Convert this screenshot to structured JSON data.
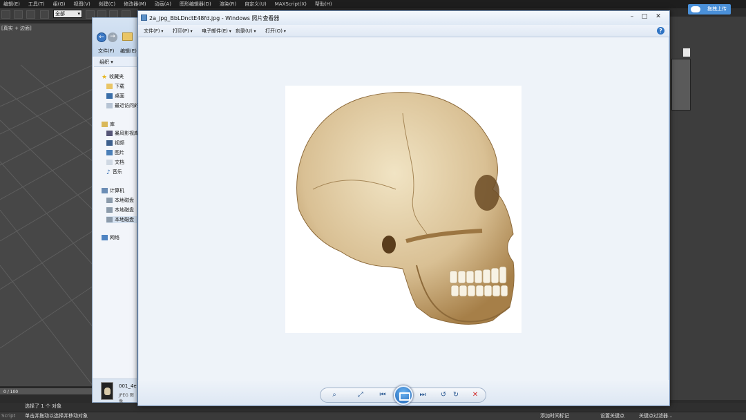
{
  "max": {
    "menu": [
      "编辑(E)",
      "工具(T)",
      "组(G)",
      "视图(V)",
      "创建(C)",
      "修改器(M)",
      "动画(A)",
      "图形编辑器(D)",
      "渲染(R)",
      "自定义(U)",
      "MAXScript(X)",
      "帮助(H)"
    ],
    "selection_filter": "全部",
    "viewport_label": "[真实 + 边面]",
    "time_slider": "0 / 100",
    "status_selected": "选择了 1 个 对象",
    "status_hint": "单击并拖动以选择并移动对象",
    "status_left": "Script",
    "set_key": "设置关键点",
    "key_filters": "关键点过滤器...",
    "add_time_tag": "添加时间标记",
    "upload_button": "拖拽上传"
  },
  "explorer": {
    "menu": [
      "文件(F)",
      "编辑(E)"
    ],
    "organize": "组织 ▾",
    "favorites": "收藏夹",
    "fav_items": [
      "下载",
      "桌面",
      "最近访问的"
    ],
    "library": "库",
    "lib_items": [
      "暴风影视库",
      "视频",
      "图片",
      "文档",
      "音乐"
    ],
    "computer": "计算机",
    "comp_items": [
      "本地磁盘",
      "本地磁盘",
      "本地磁盘"
    ],
    "network": "网络",
    "file_name": "001_4e",
    "file_type": "JPEG 图像"
  },
  "viewer": {
    "title": "2a_jpg_BbLDnctE48fd.jpg - Windows 照片查看器",
    "menu": [
      "文件(F)",
      "打印(P)",
      "电子邮件(E)",
      "刻录(U)",
      "打开(O)"
    ],
    "colors": {
      "accent": "#1d63b6",
      "frame": "#dbe6f3",
      "canvas": "#eef3f9",
      "delete": "#d22a2a"
    }
  }
}
